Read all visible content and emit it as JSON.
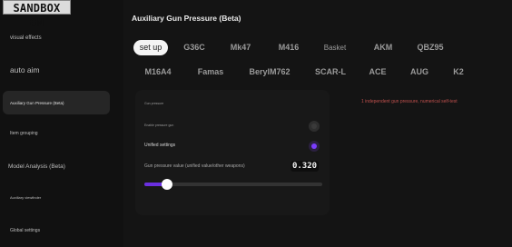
{
  "badge": "SANDBOX ON",
  "sidebar": {
    "items": [
      {
        "label": "visual effects"
      },
      {
        "label": "auto aim"
      },
      {
        "label": "Auxiliary Gun Pressure (Beta)"
      },
      {
        "label": "Item grouping"
      },
      {
        "label": "Model Analysis (Beta)"
      },
      {
        "label": "Auxiliary viewfinder"
      },
      {
        "label": "Global settings"
      }
    ]
  },
  "main": {
    "title": "Auxiliary Gun Pressure (Beta)",
    "tabs": [
      {
        "label": "set up"
      },
      {
        "label": "G36C"
      },
      {
        "label": "Mk47"
      },
      {
        "label": "M416"
      },
      {
        "label": "Basket"
      },
      {
        "label": "AKM"
      },
      {
        "label": "QBZ95"
      },
      {
        "label": "M16A4"
      },
      {
        "label": "Famas"
      },
      {
        "label": "BerylM762"
      },
      {
        "label": "SCAR-L"
      },
      {
        "label": "ACE"
      },
      {
        "label": "AUG"
      },
      {
        "label": "K2"
      }
    ],
    "settings": {
      "row1_label": "Gun pressure",
      "row2_label": "Enable pressure gun",
      "row3_label": "Unified settings",
      "row3_enabled": true,
      "row2_enabled": false,
      "value_label": "Gun pressure value (unified value/other weapons)",
      "value": "0.320",
      "slider_fraction": 0.13
    },
    "note": "1 independent gun pressure, numerical self-test"
  },
  "colors": {
    "accent": "#7b3cff",
    "note": "#c0504d"
  }
}
